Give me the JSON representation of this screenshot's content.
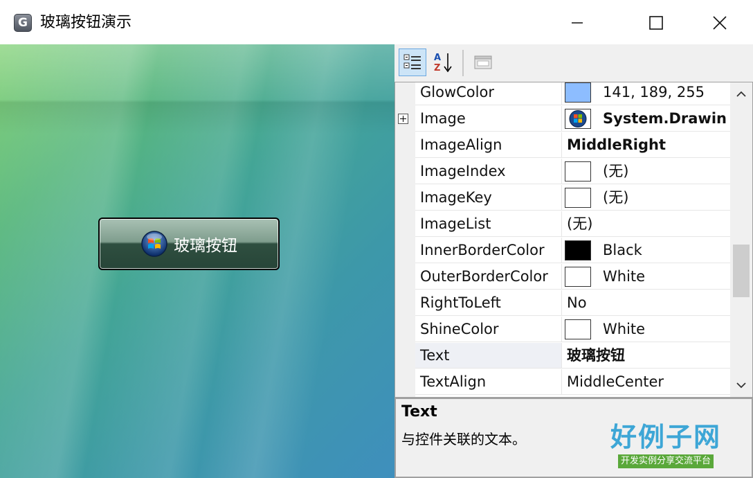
{
  "window": {
    "app_icon_letter": "G",
    "title": "玻璃按钮演示"
  },
  "demo": {
    "glass_button_label": "玻璃按钮"
  },
  "toolbar": {
    "buttons": [
      "categorized-icon",
      "alphabetical-icon",
      "property-pages-icon"
    ]
  },
  "properties": {
    "rows": [
      {
        "name": "GlowColor",
        "value": "141, 189, 255",
        "swatch": "#8dbdff"
      },
      {
        "name": "Image",
        "value": "System.Drawin",
        "bold": true,
        "expandable": true,
        "icon": "windows-logo-icon"
      },
      {
        "name": "ImageAlign",
        "value": "MiddleRight",
        "bold": true
      },
      {
        "name": "ImageIndex",
        "value": "(无)",
        "swatch": "#ffffff"
      },
      {
        "name": "ImageKey",
        "value": "(无)",
        "swatch": "#ffffff"
      },
      {
        "name": "ImageList",
        "value": "(无)"
      },
      {
        "name": "InnerBorderColor",
        "value": "Black",
        "swatch": "#000000"
      },
      {
        "name": "OuterBorderColor",
        "value": "White",
        "swatch": "#ffffff"
      },
      {
        "name": "RightToLeft",
        "value": "No"
      },
      {
        "name": "ShineColor",
        "value": "White",
        "swatch": "#ffffff"
      },
      {
        "name": "Text",
        "value": "玻璃按钮",
        "bold": true,
        "selected": true
      },
      {
        "name": "TextAlign",
        "value": "MiddleCenter"
      }
    ]
  },
  "description": {
    "title": "Text",
    "text": "与控件关联的文本。"
  },
  "brand": {
    "main": "好例子网",
    "sub": "开发实例分享交流平台"
  },
  "colors": {
    "accent_selected": "#cce4f7",
    "brand_blue": "#3da6d6",
    "brand_green": "#5aa83a"
  }
}
